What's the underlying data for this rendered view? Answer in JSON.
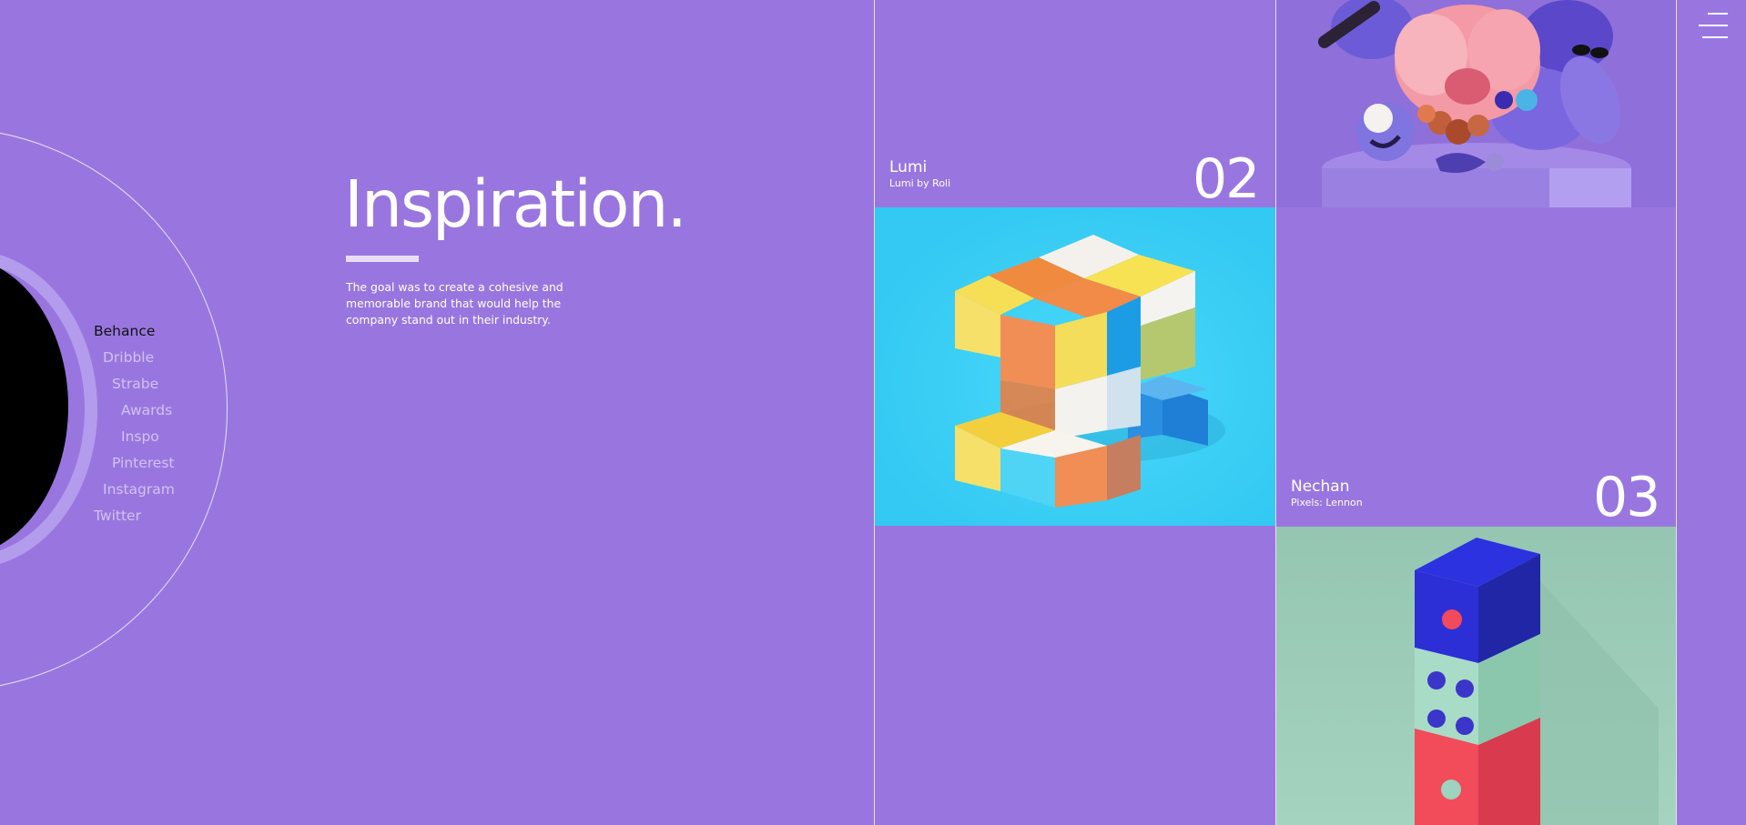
{
  "heading": "Inspiration.",
  "intro": "The goal was to create a cohesive and memorable brand that would help the company stand out in their industry.",
  "social_links": [
    {
      "label": "Behance",
      "active": true
    },
    {
      "label": "Dribble",
      "active": false
    },
    {
      "label": "Strabe",
      "active": false
    },
    {
      "label": "Awards",
      "active": false
    },
    {
      "label": "Inspo",
      "active": false
    },
    {
      "label": "Pinterest",
      "active": false
    },
    {
      "label": "Instagram",
      "active": false
    },
    {
      "label": "Twitter",
      "active": false
    }
  ],
  "projects": [
    {
      "title": "Lumi",
      "subtitle": "Lumi by Roli",
      "number": "02"
    },
    {
      "title": "Nechan",
      "subtitle": "Pixels: Lennon",
      "number": "03"
    }
  ],
  "icons": {
    "menu": "hamburger-menu-icon"
  },
  "colors": {
    "background": "#9976df",
    "cubes_tile": "#3ed0f6",
    "dice_tile": "#9acbb6",
    "active_link": "#121212"
  }
}
